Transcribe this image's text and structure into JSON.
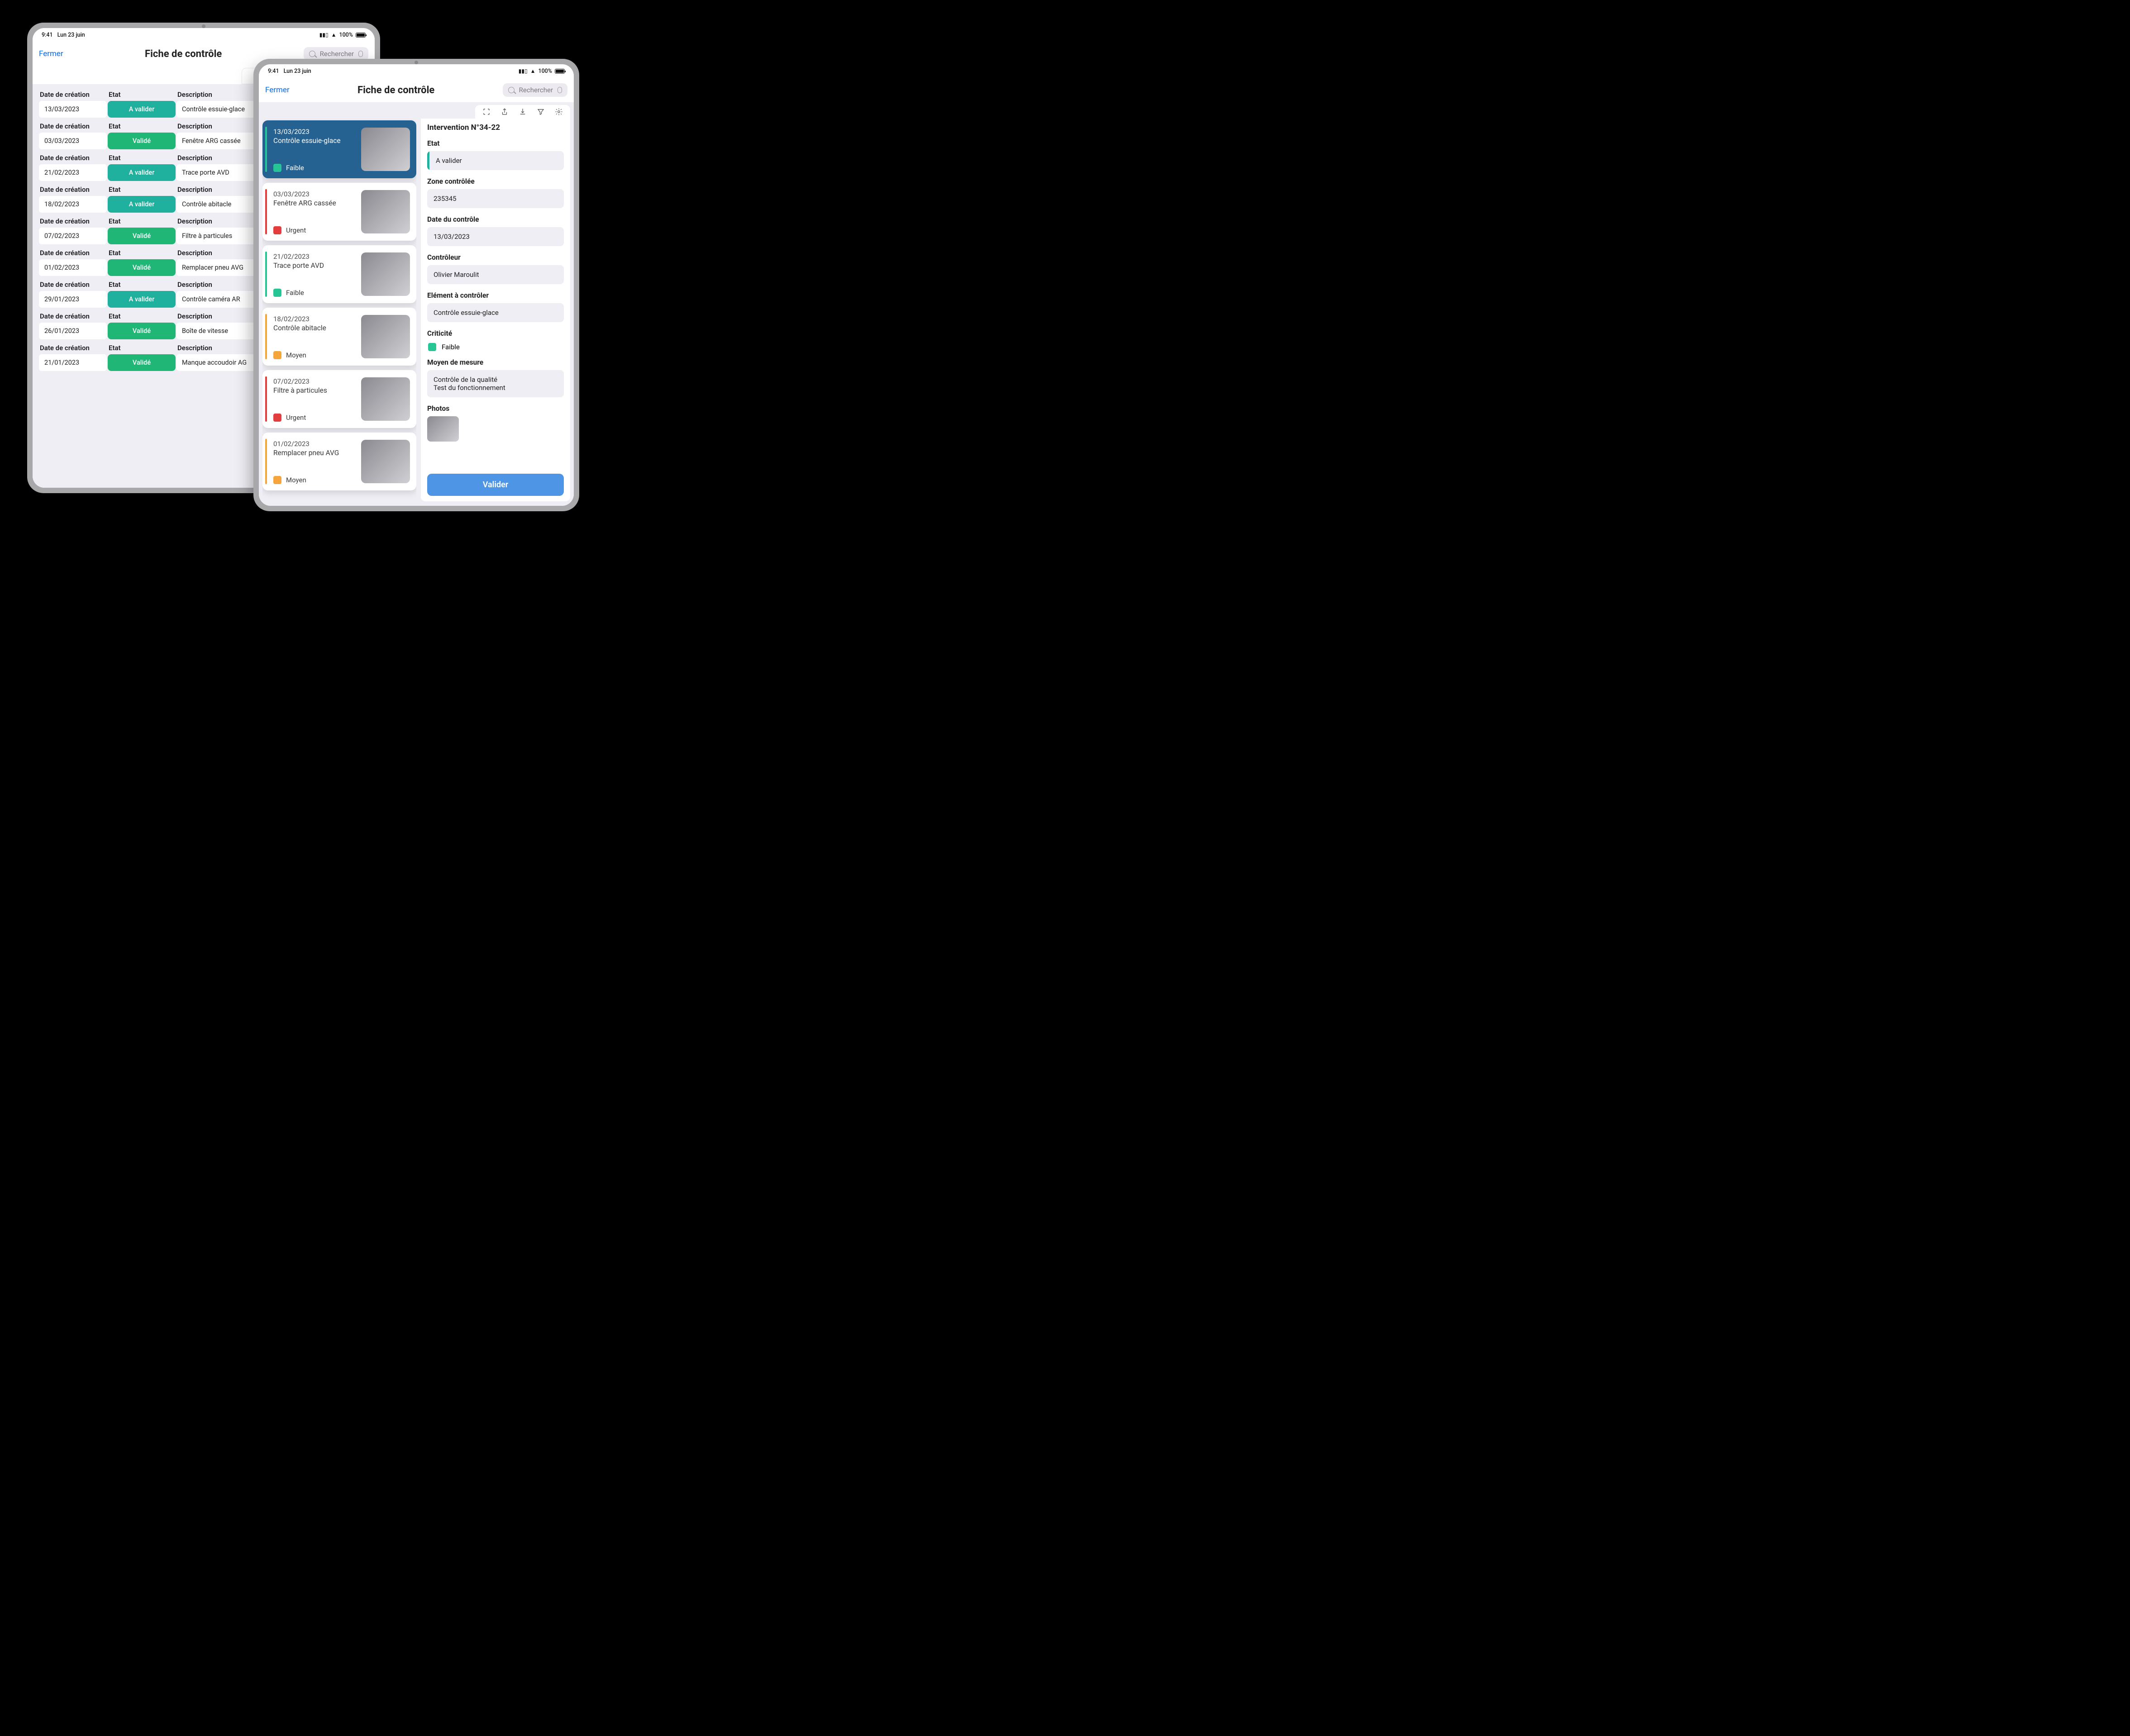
{
  "status": {
    "time": "9:41",
    "date": "Lun 23 juin",
    "battery": "100%"
  },
  "header": {
    "close": "Fermer",
    "title": "Fiche de contrôle",
    "search_placeholder": "Rechercher"
  },
  "labels": {
    "date": "Date de création",
    "etat": "Etat",
    "desc": "Description",
    "photos": "Photos",
    "crit": "Criticité"
  },
  "etats": {
    "a_valider": "A valider",
    "valide": "Validé"
  },
  "crits": {
    "faible": "Faible",
    "moyen": "Moyen",
    "urgent": "Urgent"
  },
  "rows": [
    {
      "date": "13/03/2023",
      "etat": "a_valider",
      "desc": "Contrôle essuie-glace",
      "crit": "faible"
    },
    {
      "date": "03/03/2023",
      "etat": "valide",
      "desc": "Fenêtre ARG cassée",
      "crit": "urgent"
    },
    {
      "date": "21/02/2023",
      "etat": "a_valider",
      "desc": "Trace porte AVD",
      "crit": "faible"
    },
    {
      "date": "18/02/2023",
      "etat": "a_valider",
      "desc": "Contrôle abitacle",
      "crit": "moyen"
    },
    {
      "date": "07/02/2023",
      "etat": "valide",
      "desc": "Filtre à particules",
      "crit": "urgent"
    },
    {
      "date": "01/02/2023",
      "etat": "valide",
      "desc": "Remplacer pneu AVG",
      "crit": "moyen"
    },
    {
      "date": "29/01/2023",
      "etat": "a_valider",
      "desc": "Contrôle caméra AR",
      "crit": "faible"
    },
    {
      "date": "26/01/2023",
      "etat": "valide",
      "desc": "Boîte de vitesse",
      "crit": "moyen"
    },
    {
      "date": "21/01/2023",
      "etat": "valide",
      "desc": "Manque accoudoir AG",
      "crit": "faible"
    }
  ],
  "cards": [
    {
      "date": "13/03/2023",
      "desc": "Contrôle essuie-glace",
      "crit": "faible",
      "selected": true
    },
    {
      "date": "03/03/2023",
      "desc": "Fenêtre ARG cassée",
      "crit": "urgent"
    },
    {
      "date": "21/02/2023",
      "desc": "Trace porte AVD",
      "crit": "faible"
    },
    {
      "date": "18/02/2023",
      "desc": "Contrôle abitacle",
      "crit": "moyen"
    },
    {
      "date": "07/02/2023",
      "desc": "Filtre à particules",
      "crit": "urgent"
    },
    {
      "date": "01/02/2023",
      "desc": "Remplacer pneu AVG",
      "crit": "moyen"
    }
  ],
  "detail": {
    "title": "Intervention N°34-22",
    "etat_label": "Etat",
    "etat_value": "A valider",
    "zone_label": "Zone contrôlée",
    "zone_value": "235345",
    "date_label": "Date du contrôle",
    "date_value": "13/03/2023",
    "controleur_label": "Contrôleur",
    "controleur_value": "Olivier Maroulit",
    "element_label": "Elément à contrôler",
    "element_value": "Contrôle essuie-glace",
    "crit_label": "Criticité",
    "crit_value": "faible",
    "moyen_label": "Moyen de mesure",
    "moyen_line1": "Contrôle de la qualité",
    "moyen_line2": "Test du fonctionnement",
    "photos_label": "Photos",
    "validate_btn": "Valider"
  }
}
